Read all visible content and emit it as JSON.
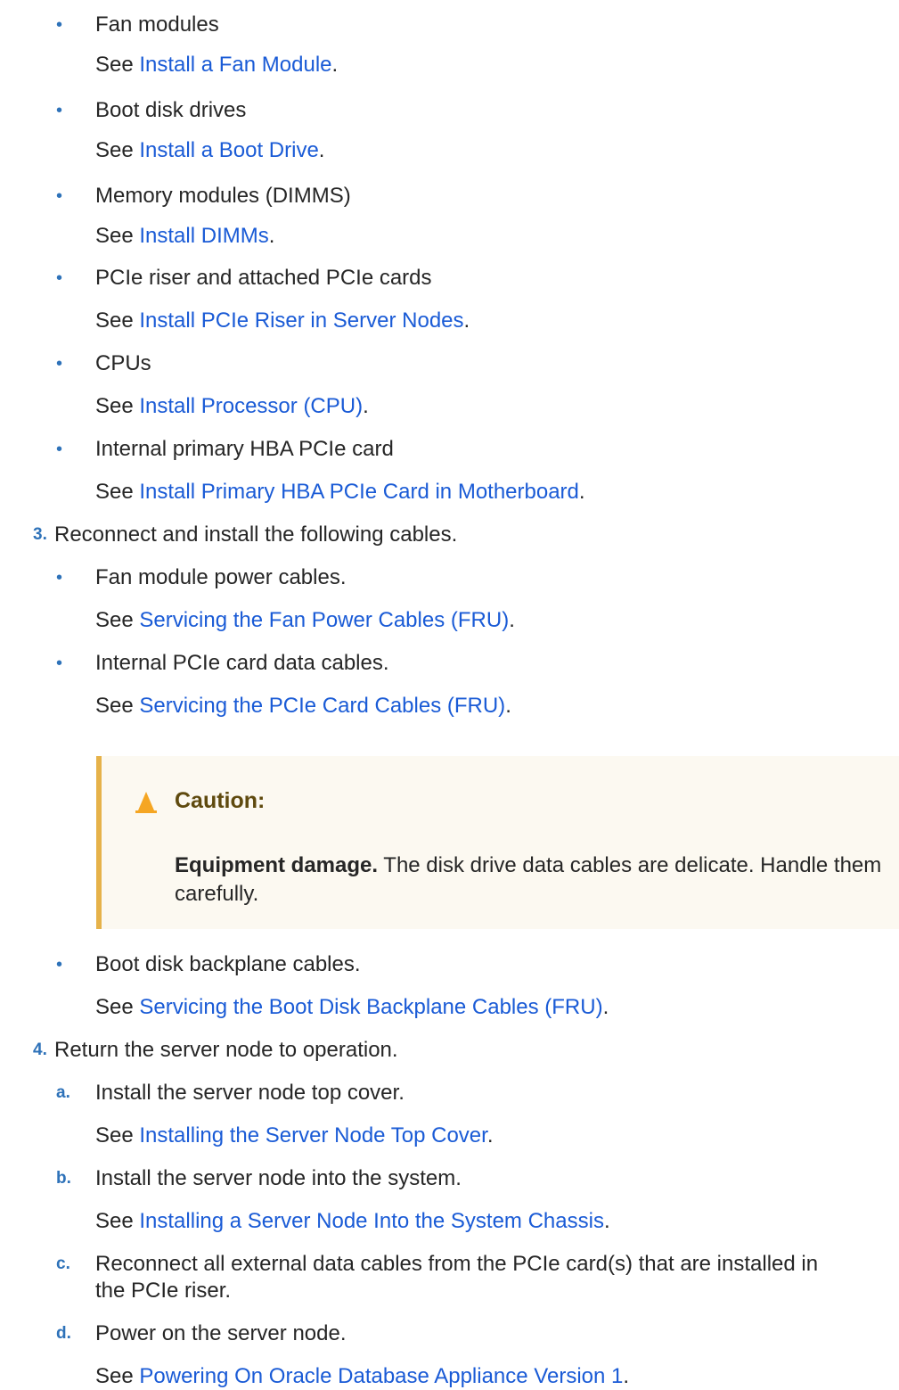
{
  "list_a": {
    "items": [
      {
        "text": "Fan modules",
        "see": "See ",
        "link": "Install a Fan Module",
        "end": "."
      },
      {
        "text": "Boot disk drives",
        "see": "See ",
        "link": "Install a Boot Drive",
        "end": "."
      },
      {
        "text": "Memory modules (DIMMS)",
        "see": "See ",
        "link": "Install DIMMs",
        "end": "."
      },
      {
        "text": "PCIe riser and attached PCIe cards",
        "see": "See ",
        "link": "Install PCIe Riser in Server Nodes",
        "end": "."
      },
      {
        "text": "CPUs",
        "see": "See ",
        "link": "Install Processor (CPU)",
        "end": "."
      },
      {
        "text": "Internal primary HBA PCIe card",
        "see": "See ",
        "link": "Install Primary HBA PCIe Card in Motherboard",
        "end": "."
      }
    ]
  },
  "step3": {
    "number": "3.",
    "text": "Reconnect and install the following cables.",
    "items": [
      {
        "text": "Fan module power cables.",
        "see": "See ",
        "link": "Servicing the Fan Power Cables (FRU)",
        "end": "."
      },
      {
        "text": "Internal PCIe card data cables.",
        "see": "See ",
        "link": "Servicing the PCIe Card Cables (FRU)",
        "end": "."
      },
      {
        "text": "Boot disk backplane cables.",
        "see": "See ",
        "link": "Servicing the Boot Disk Backplane Cables (FRU)",
        "end": "."
      }
    ]
  },
  "caution": {
    "title": "Caution:",
    "bold_lead": "Equipment damage.",
    "body": " The disk drive data cables are delicate. Handle them carefully.",
    "icon": "warning-cone-icon",
    "accent_color": "#e6b24a",
    "background_color": "#fcf9f1"
  },
  "step4": {
    "number": "4.",
    "text": "Return the server node to operation.",
    "substeps": [
      {
        "letter": "a.",
        "text": "Install the server node top cover.",
        "see": "See ",
        "link": "Installing the Server Node Top Cover",
        "end": "."
      },
      {
        "letter": "b.",
        "text": "Install the server node into the system.",
        "see": "See ",
        "link": "Installing a Server Node Into the System Chassis",
        "end": "."
      },
      {
        "letter": "c.",
        "text_line1": "Reconnect all external data cables from the PCIe card(s) that are installed in",
        "text_line2": "the PCIe riser."
      },
      {
        "letter": "d.",
        "text": "Power on the server node.",
        "see": "See ",
        "link": "Powering On Oracle Database Appliance Version 1",
        "end": "."
      }
    ]
  },
  "bullet_glyph": "•",
  "colors": {
    "link": "#1a5bd6",
    "step_number": "#2e72b9",
    "text": "#262626"
  }
}
